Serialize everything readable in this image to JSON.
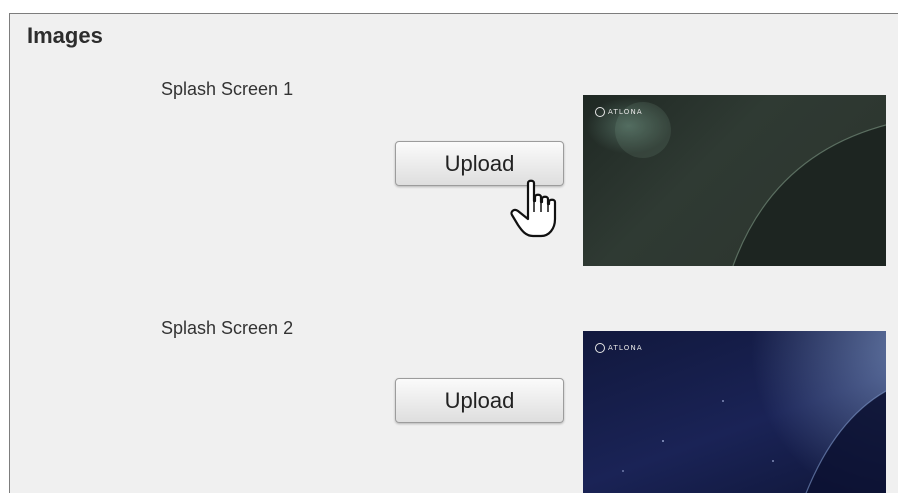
{
  "section": {
    "title": "Images"
  },
  "splash_screens": [
    {
      "label": "Splash Screen 1",
      "upload_label": "Upload",
      "logo_text": "ATLONA"
    },
    {
      "label": "Splash Screen 2",
      "upload_label": "Upload",
      "logo_text": "ATLONA"
    }
  ],
  "icons": {
    "cursor": "hand-pointer-icon"
  }
}
